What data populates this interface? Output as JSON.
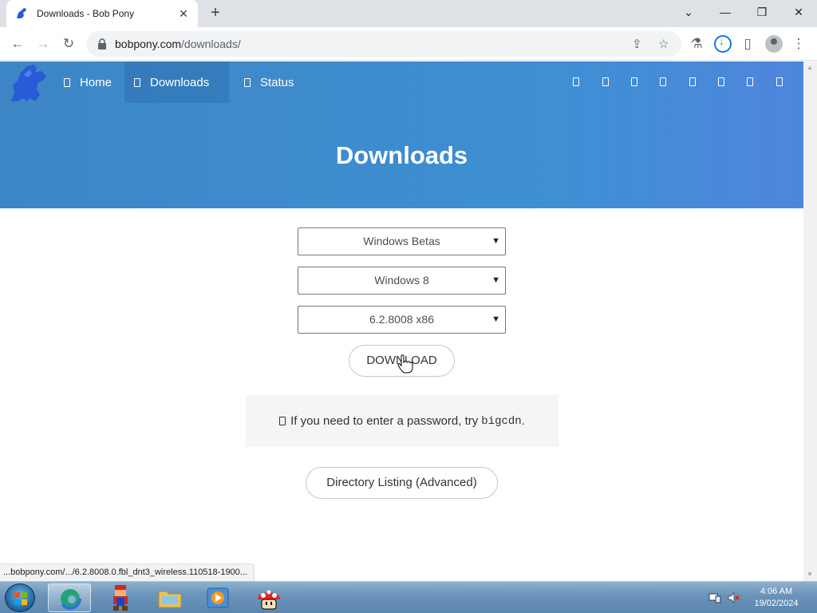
{
  "browser": {
    "tab_title": "Downloads - Bob Pony",
    "tab_close": "✕",
    "new_tab": "+",
    "url_host": "bobpony.com",
    "url_path": "/downloads/",
    "controls": {
      "minimize": "—",
      "maximize": "❐",
      "close": "✕",
      "tab_search": "⌄"
    }
  },
  "nav": {
    "items": [
      {
        "label": "Home"
      },
      {
        "label": "Downloads",
        "active": true
      },
      {
        "label": "Status"
      }
    ],
    "social_icon_count": 8
  },
  "hero": {
    "title": "Downloads"
  },
  "form": {
    "category_select": "Windows Betas",
    "product_select": "Windows 8",
    "build_select": "6.2.8008 x86",
    "download_label": "DOWNLOAD"
  },
  "notice": {
    "text": " If you need to enter a password, try",
    "code": "bigcdn",
    "suffix": "."
  },
  "directory_label": "Directory Listing (Advanced)",
  "status_bar": "...bobpony.com/.../6.2.8008.0.fbl_dnt3_wireless.110518-1900...",
  "taskbar": {
    "clock_time": "4:06 AM",
    "clock_date": "19/02/2024"
  },
  "colors": {
    "hero_blue": "#3e8fd4",
    "tab_strip": "#dee1e6",
    "taskbar": "#6d95bb"
  }
}
